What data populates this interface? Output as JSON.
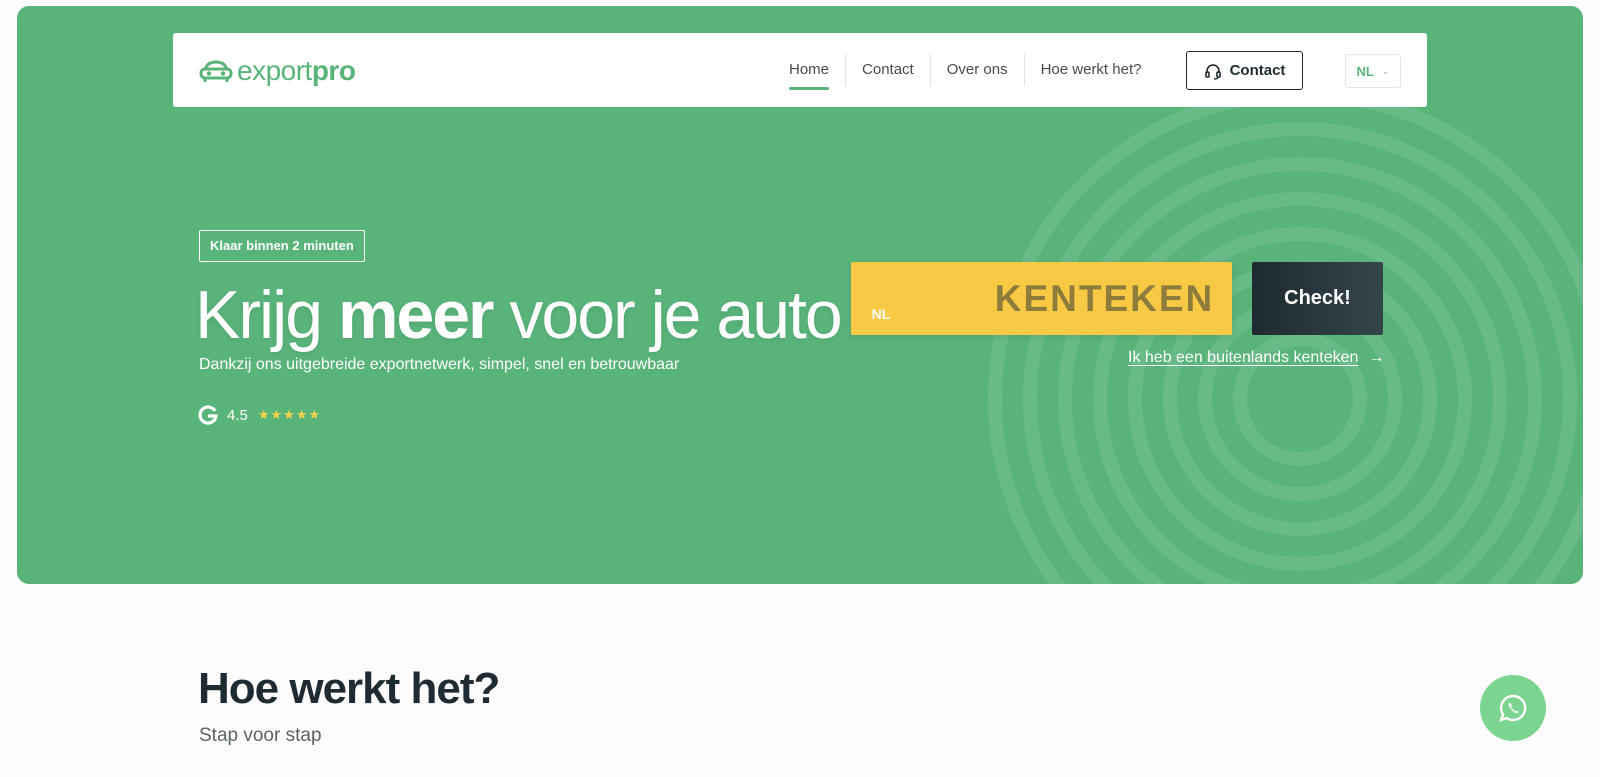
{
  "nav": {
    "logo_light": "export",
    "logo_bold": "pro",
    "links": [
      "Home",
      "Contact",
      "Over ons",
      "Hoe werkt het?"
    ],
    "contact_button": "Contact",
    "language": "NL"
  },
  "hero": {
    "badge_prefix": "Klaar binnen ",
    "badge_bold": "2 minuten",
    "headline_1": "Krijg ",
    "headline_strong": "meer",
    "headline_2": " voor je auto",
    "subtitle": "Dankzij ons uitgebreide exportnetwerk, simpel, snel en betrouwbaar",
    "rating": "4.5",
    "stars": "★★★★★"
  },
  "plate": {
    "country": "NL",
    "placeholder": "KENTEKEN",
    "check_label": "Check!",
    "foreign_link": "Ik heb een buitenlands kenteken"
  },
  "section": {
    "title": "Hoe werkt het?",
    "subtitle": "Stap voor stap"
  },
  "colors": {
    "brand_green": "#59b47a",
    "plate_yellow": "#f7c945",
    "eu_blue": "#3f5fd6",
    "dark": "#1f2b33",
    "whatsapp": "#7bd48f"
  },
  "icons": {
    "logo": "car-logo-icon",
    "contact": "headset-icon",
    "language": "chevron-down-icon",
    "rating": "google-icon",
    "link": "arrow-right-icon",
    "chat": "whatsapp-icon"
  }
}
